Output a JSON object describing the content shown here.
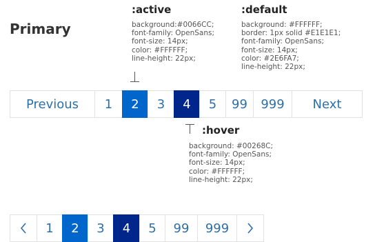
{
  "title": "Primary",
  "states": {
    "active": {
      "name": ":active",
      "lines": [
        "background:#0066CC;",
        "font-family: OpenSans;",
        "font-size: 14px;",
        "color: #FFFFFF;",
        "line-height: 22px;"
      ]
    },
    "default": {
      "name": ":default",
      "lines": [
        "background: #FFFFFF;",
        "border: 1px solid #E1E1E1;",
        "font-family: OpenSans;",
        "font-size: 14px;",
        "color: #2E6FA7;",
        "line-height: 22px;"
      ]
    },
    "hover": {
      "name": ":hover",
      "lines": [
        "background: #00268C;",
        "font-family: OpenSans;",
        "font-size: 14px;",
        "color: #FFFFFF;",
        "line-height: 22px;"
      ]
    }
  },
  "pager_full": {
    "previous_label": "Previous",
    "next_label": "Next",
    "pages": [
      "1",
      "2",
      "3",
      "4",
      "5",
      "99",
      "999"
    ]
  },
  "pager_compact": {
    "prev_icon": "chevron-left-icon",
    "next_icon": "chevron-right-icon",
    "pages": [
      "1",
      "2",
      "3",
      "4",
      "5",
      "99",
      "999"
    ]
  },
  "colors": {
    "active_bg": "#0066CC",
    "hover_bg": "#00268C",
    "default_text": "#2E6FA7",
    "border": "#E1E1E1"
  }
}
